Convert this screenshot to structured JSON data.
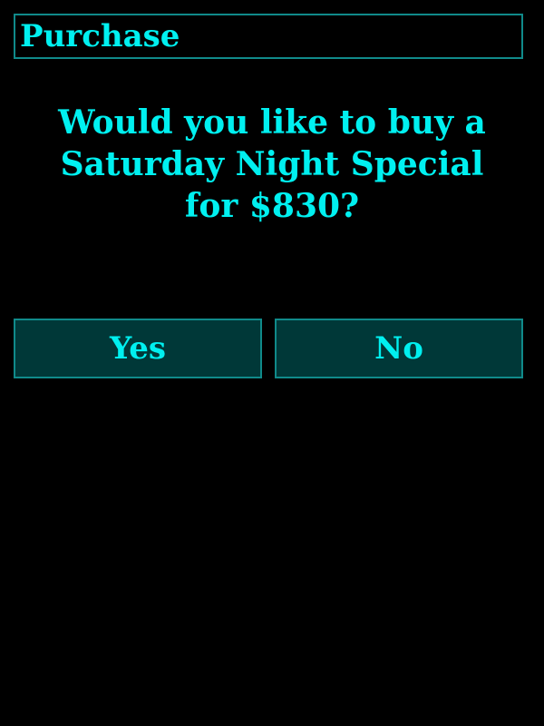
{
  "dialog": {
    "title": "Purchase",
    "prompt": "Would you like to buy a Saturday Night Special for $830?",
    "yes_label": "Yes",
    "no_label": "No"
  },
  "colors": {
    "background": "#000000",
    "text": "#00f0f0",
    "border": "#108a8a",
    "button_fill": "#003838"
  }
}
